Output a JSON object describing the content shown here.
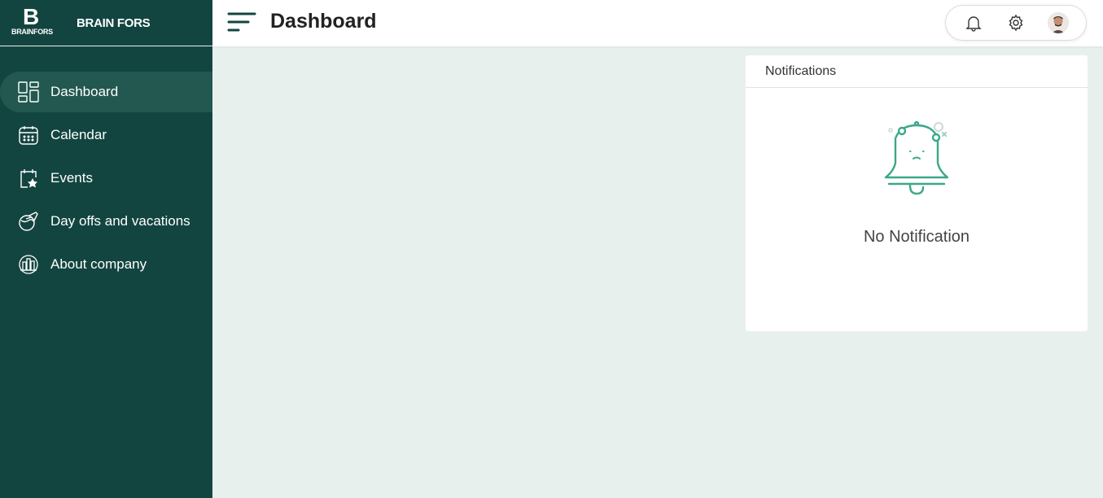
{
  "brand": {
    "logo_letter": "B",
    "logo_sub": "BRAINFORS",
    "name": "BRAIN FORS"
  },
  "sidebar": {
    "items": [
      {
        "label": "Dashboard",
        "icon": "dashboard-grid-icon",
        "active": true
      },
      {
        "label": "Calendar",
        "icon": "calendar-icon",
        "active": false
      },
      {
        "label": "Events",
        "icon": "calendar-star-icon",
        "active": false
      },
      {
        "label": "Day offs and vacations",
        "icon": "plane-globe-icon",
        "active": false
      },
      {
        "label": "About company",
        "icon": "building-icon",
        "active": false
      }
    ]
  },
  "header": {
    "title": "Dashboard",
    "actions": [
      {
        "icon": "bell-icon"
      },
      {
        "icon": "gear-icon"
      },
      {
        "icon": "user-avatar"
      }
    ]
  },
  "notifications": {
    "title": "Notifications",
    "empty_message": "No Notification"
  },
  "colors": {
    "sidebar_bg": "#134540",
    "active_item_bg": "#22584f",
    "accent": "#3aa889",
    "content_bg": "#e8f0ee"
  }
}
